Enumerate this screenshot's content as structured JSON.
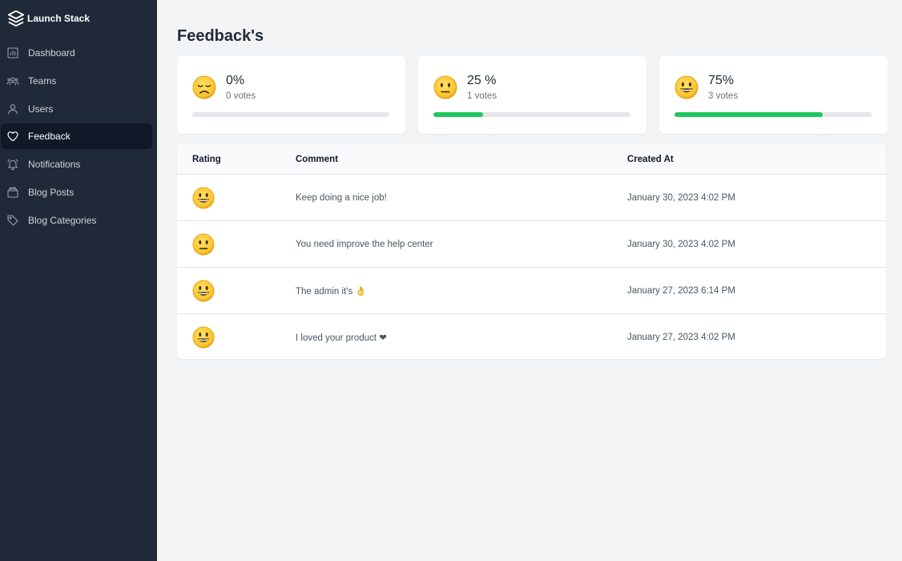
{
  "app": {
    "name": "Launch Stack"
  },
  "sidebar": {
    "items": [
      {
        "label": "Dashboard",
        "icon": "chart-icon",
        "active": false
      },
      {
        "label": "Teams",
        "icon": "users-group-icon",
        "active": false
      },
      {
        "label": "Users",
        "icon": "user-icon",
        "active": false
      },
      {
        "label": "Feedback",
        "icon": "heart-icon",
        "active": true
      },
      {
        "label": "Notifications",
        "icon": "bell-icon",
        "active": false
      },
      {
        "label": "Blog Posts",
        "icon": "folder-icon",
        "active": false
      },
      {
        "label": "Blog Categories",
        "icon": "tag-icon",
        "active": false
      }
    ]
  },
  "page": {
    "title": "Feedback's"
  },
  "stats": [
    {
      "emoji": "sad-face-icon",
      "percent_text": "0%",
      "votes_text": "0 votes",
      "progress": 0
    },
    {
      "emoji": "neutral-face-icon",
      "percent_text": "25 %",
      "votes_text": "1 votes",
      "progress": 25
    },
    {
      "emoji": "happy-face-icon",
      "percent_text": "75%",
      "votes_text": "3 votes",
      "progress": 75
    }
  ],
  "table": {
    "headers": {
      "rating": "Rating",
      "comment": "Comment",
      "created_at": "Created At"
    },
    "rows": [
      {
        "rating": "happy-face-icon",
        "comment": "Keep doing a nice job!",
        "created_at": "January 30, 2023 4:02 PM"
      },
      {
        "rating": "neutral-face-icon",
        "comment": "You need improve the help center",
        "created_at": "January 30, 2023 4:02 PM"
      },
      {
        "rating": "happy-face-icon",
        "comment": "The admin it's 👌",
        "created_at": "January 27, 2023 6:14 PM"
      },
      {
        "rating": "happy-face-icon",
        "comment": "I loved your product ❤",
        "created_at": "January 27, 2023 4:02 PM"
      }
    ]
  },
  "colors": {
    "sidebar_bg": "#1f2937",
    "active_bg": "#111827",
    "progress": "#22c55e",
    "track": "#e5e7eb"
  }
}
